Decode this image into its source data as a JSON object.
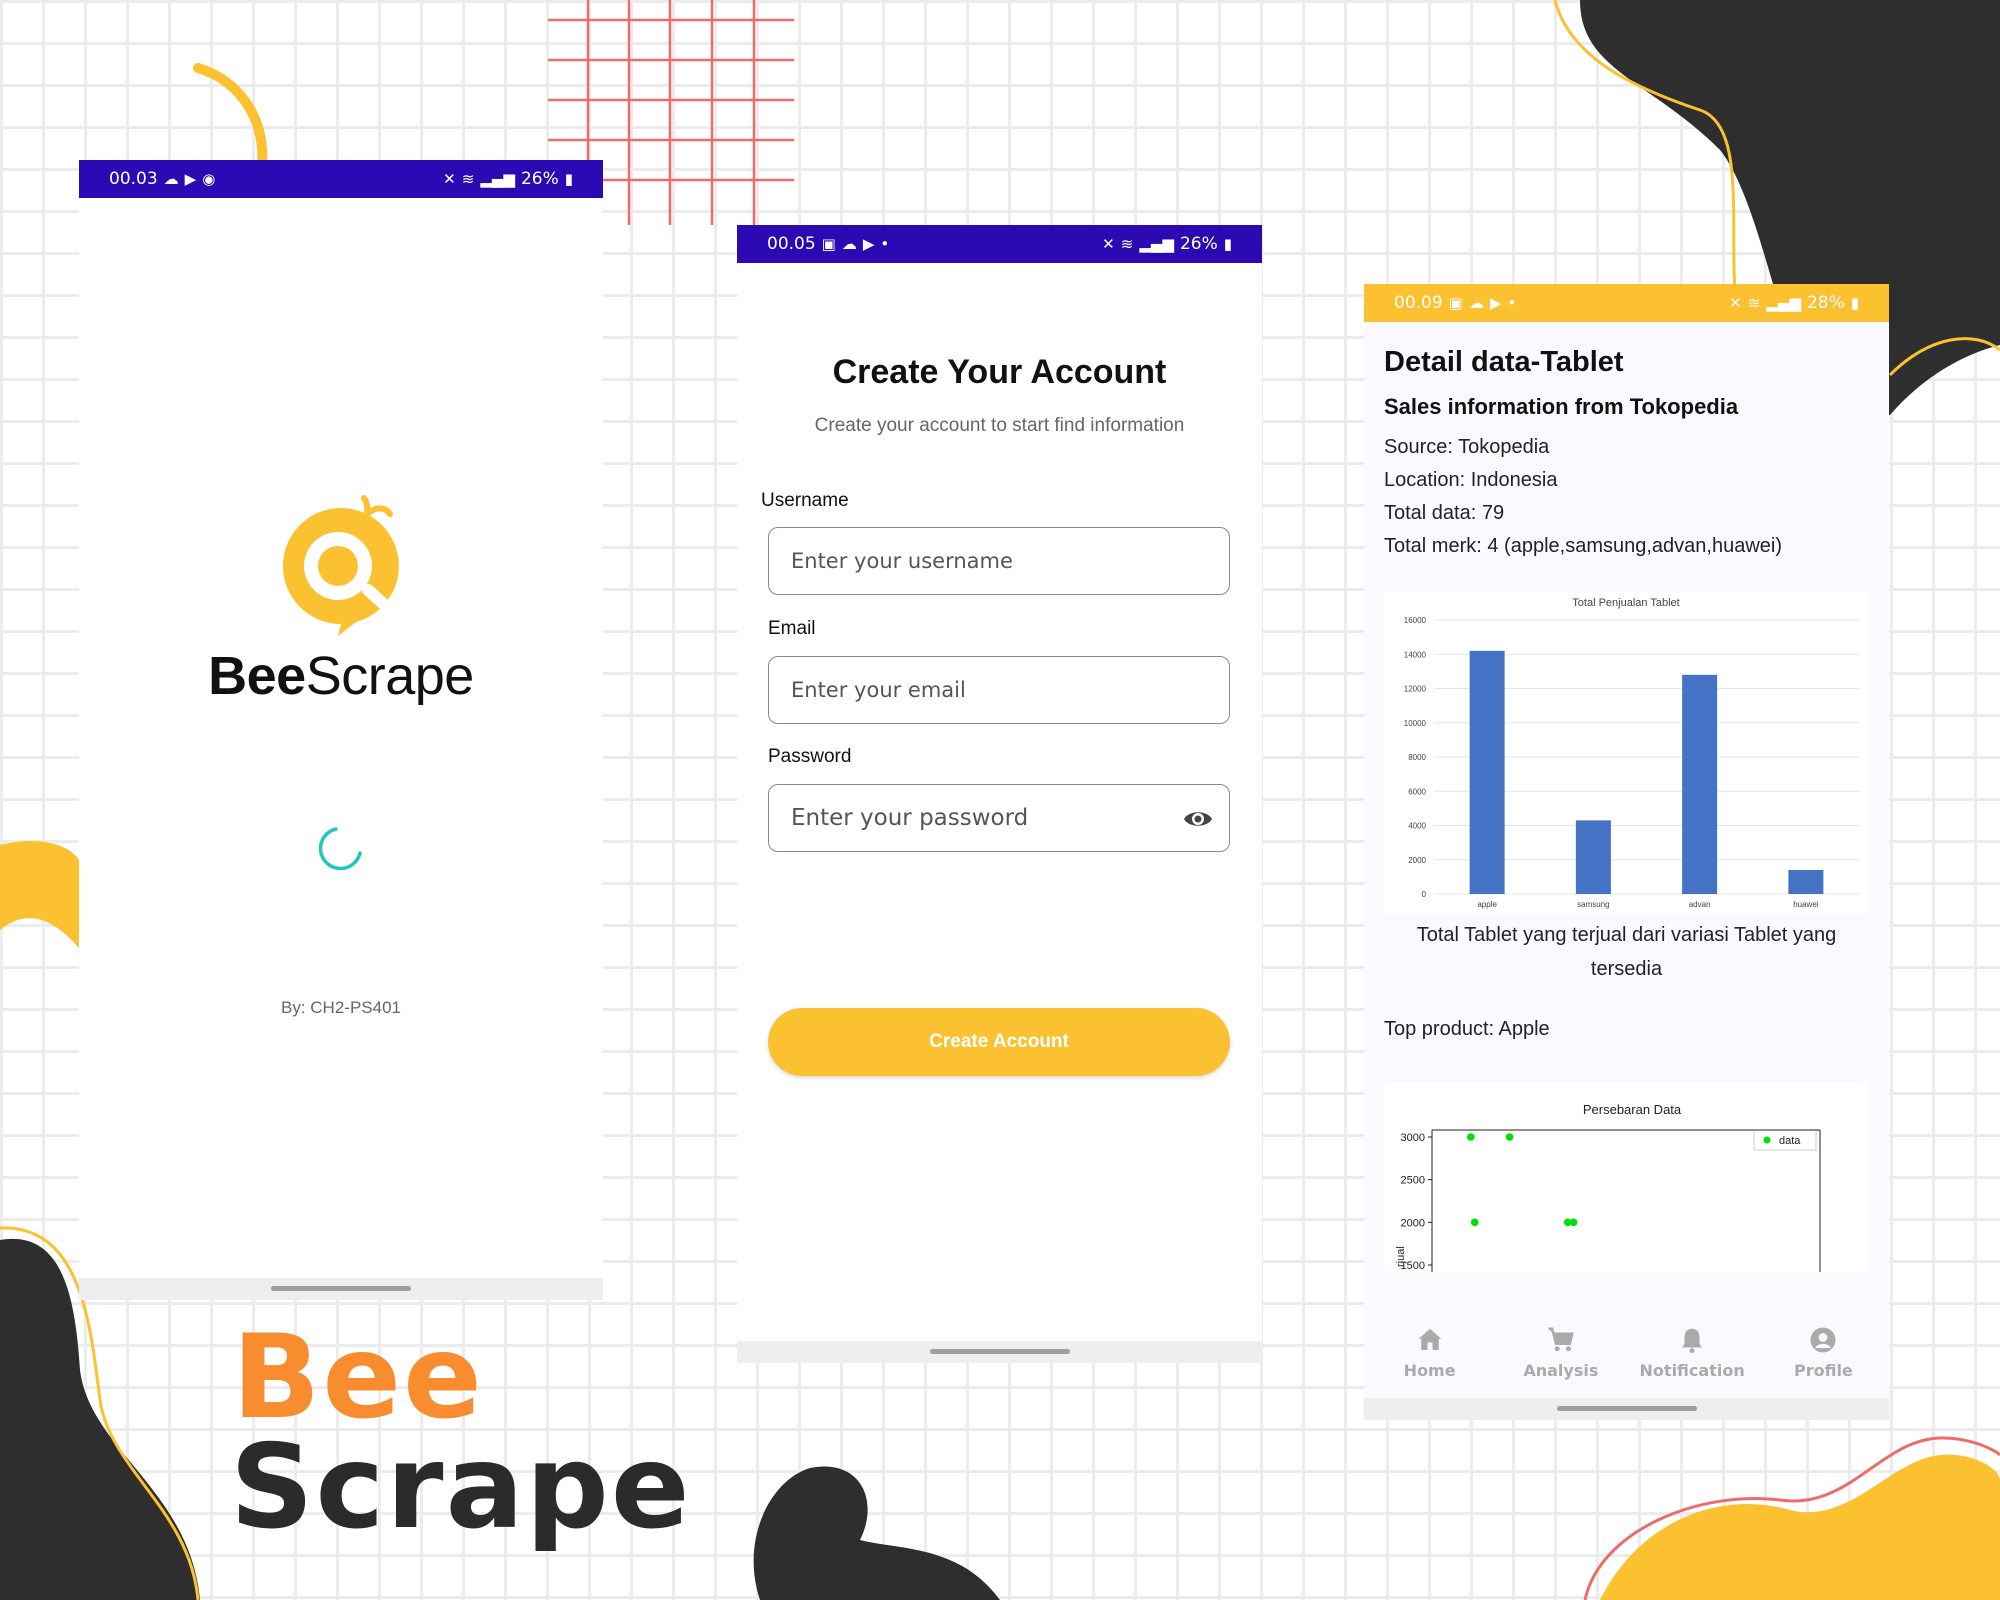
{
  "splash": {
    "status_time": "00.03",
    "status_battery": "26%",
    "brand_bee": "Bee",
    "brand_scrape": "Scrape",
    "byline": "By: CH2-PS401"
  },
  "register": {
    "status_time": "00.05",
    "status_battery": "26%",
    "title": "Create Your Account",
    "subtitle": "Create your account to start find information",
    "username_label": "Username",
    "username_placeholder": "Enter your username",
    "email_label": "Email",
    "email_placeholder": "Enter your email",
    "password_label": "Password",
    "password_placeholder": "Enter your password",
    "submit_label": "Create Account"
  },
  "detail": {
    "status_time": "00.09",
    "status_battery": "28%",
    "title": "Detail data-Tablet",
    "subtitle": "Sales information from Tokopedia",
    "source": "Source: Tokopedia",
    "location": "Location: Indonesia",
    "total_data": "Total data: 79",
    "total_merk": "Total merk: 4 (apple,samsung,advan,huawei)",
    "chart_caption": "Total Tablet yang terjual dari variasi Tablet yang tersedia",
    "top_product": "Top product: Apple",
    "nav": [
      "Home",
      "Analysis",
      "Notification",
      "Profile"
    ]
  },
  "wordmark": {
    "line1": "Bee",
    "line2": "Scrape"
  },
  "colors": {
    "primary_yellow": "#fcc131",
    "status_purple": "#2b0ab3",
    "bar_blue": "#4472c4",
    "spinner_teal": "#22c6c0",
    "wordmark_orange": "#f98c2e"
  },
  "chart_data": [
    {
      "type": "bar",
      "title": "Total Penjualan Tablet",
      "categories": [
        "apple",
        "samsung",
        "advan",
        "huawei"
      ],
      "values": [
        14200,
        4300,
        12800,
        1400
      ],
      "yticks": [
        "0",
        "2000",
        "4000",
        "6000",
        "8000",
        "10000",
        "12000",
        "14000",
        "16000"
      ],
      "ylim": [
        0,
        16000
      ],
      "grid": true
    },
    {
      "type": "scatter",
      "title": "Persebaran Data",
      "ylabel": "rjual",
      "yticks": [
        "1500",
        "2000",
        "2500",
        "3000"
      ],
      "ylim": [
        1500,
        3050
      ],
      "legend": "data",
      "legend_position": "top-right",
      "points": [
        {
          "x": 1.0,
          "y": 3000
        },
        {
          "x": 2.0,
          "y": 3000
        },
        {
          "x": 1.1,
          "y": 2000
        },
        {
          "x": 3.5,
          "y": 2000
        },
        {
          "x": 3.65,
          "y": 2000
        }
      ],
      "xlim": [
        0,
        10
      ]
    }
  ]
}
